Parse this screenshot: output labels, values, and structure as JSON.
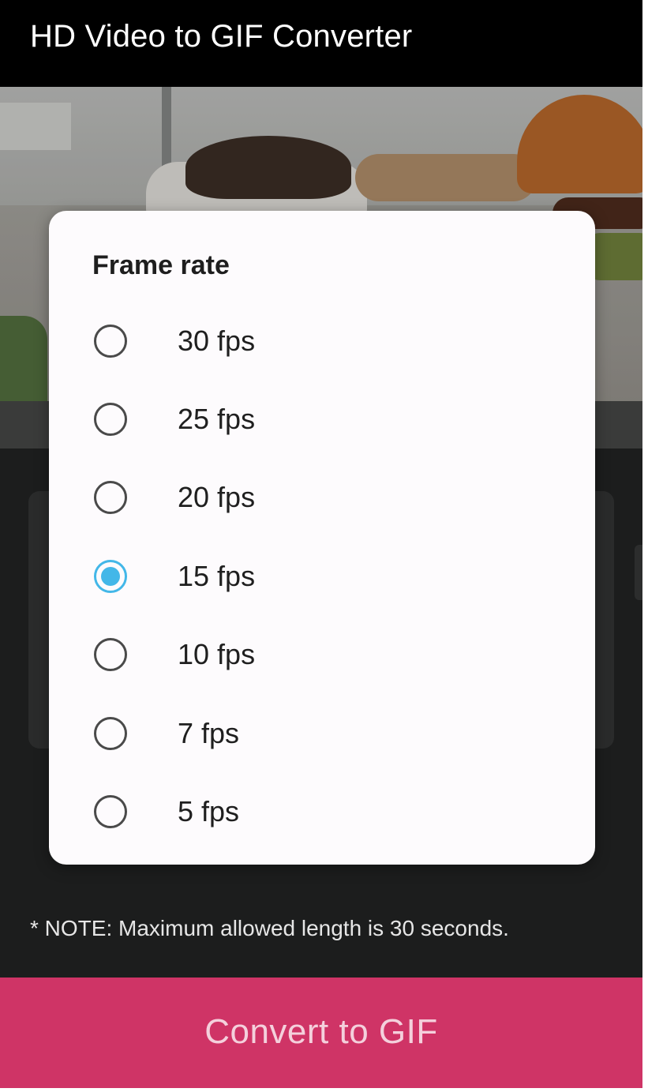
{
  "app_bar": {
    "title": "HD Video to GIF Converter"
  },
  "dialog": {
    "title": "Frame rate",
    "options": [
      {
        "label": "30 fps",
        "selected": false
      },
      {
        "label": "25 fps",
        "selected": false
      },
      {
        "label": "20 fps",
        "selected": false
      },
      {
        "label": "15 fps",
        "selected": true
      },
      {
        "label": "10 fps",
        "selected": false
      },
      {
        "label": "7 fps",
        "selected": false
      },
      {
        "label": "5 fps",
        "selected": false
      }
    ]
  },
  "note": "* NOTE: Maximum allowed length is 30 seconds.",
  "convert_button": {
    "label": "Convert to GIF"
  },
  "colors": {
    "app_bar": "#000000",
    "accent_radio": "#43b7e8",
    "convert_button": "#cf3466",
    "background": "#1c1d1d"
  }
}
